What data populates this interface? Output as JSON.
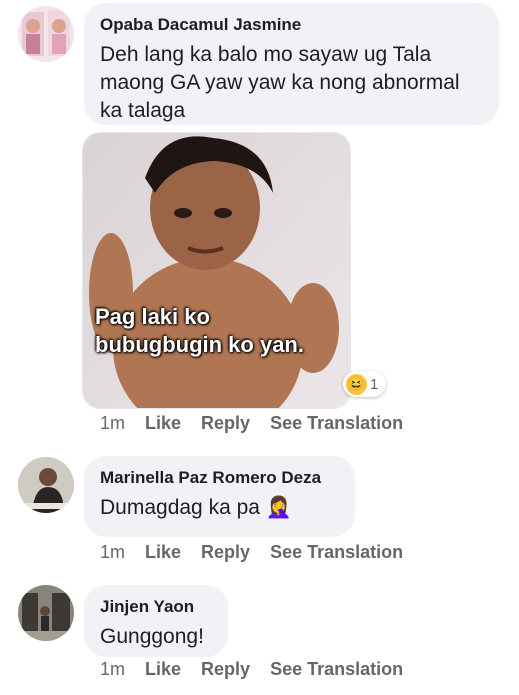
{
  "comments": [
    {
      "author": "Opaba Dacamul Jasmine",
      "text": "Deh lang ka balo mo sayaw ug Tala maong GA yaw yaw ka nong abnormal ka talaga",
      "image_caption_line1": "Pag laki ko",
      "image_caption_line2": "bubugbugin ko yan.",
      "reaction_icon": "haha-emoji-icon",
      "reaction_count": "1",
      "time": "1m",
      "like": "Like",
      "reply": "Reply",
      "see_translation": "See Translation"
    },
    {
      "author": "Marinella Paz Romero Deza",
      "text": "Dumagdag ka pa 🤦‍♀️",
      "time": "1m",
      "like": "Like",
      "reply": "Reply",
      "see_translation": "See Translation"
    },
    {
      "author": "Jinjen Yaon",
      "text": "Gunggong!",
      "time": "1m",
      "like": "Like",
      "reply": "Reply",
      "see_translation": "See Translation"
    }
  ],
  "colors": {
    "bubble": "#f0f2f5",
    "text": "#1c1e21",
    "secondary": "#65676b",
    "haha": "#f7c23a"
  }
}
